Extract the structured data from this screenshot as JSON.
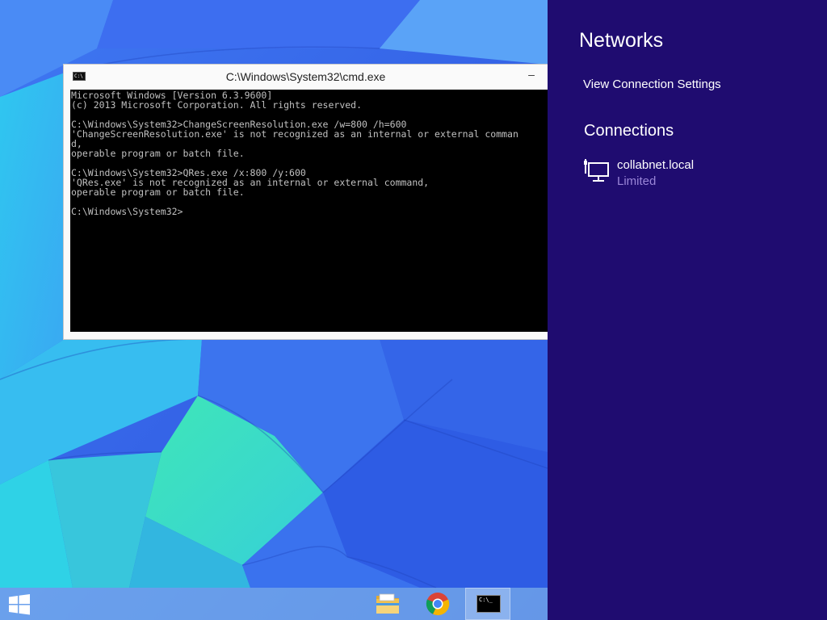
{
  "cmd": {
    "title": "C:\\Windows\\System32\\cmd.exe",
    "icon_text": "C:\\",
    "minimize_glyph": "–",
    "lines": [
      "Microsoft Windows [Version 6.3.9600]",
      "(c) 2013 Microsoft Corporation. All rights reserved.",
      "",
      "C:\\Windows\\System32>ChangeScreenResolution.exe /w=800 /h=600",
      "'ChangeScreenResolution.exe' is not recognized as an internal or external comman",
      "d,",
      "operable program or batch file.",
      "",
      "C:\\Windows\\System32>QRes.exe /x:800 /y:600",
      "'QRes.exe' is not recognized as an internal or external command,",
      "operable program or batch file.",
      "",
      "C:\\Windows\\System32>"
    ]
  },
  "charm": {
    "title": "Networks",
    "view_settings_label": "View Connection Settings",
    "connections_heading": "Connections",
    "connection": {
      "name": "collabnet.local",
      "status": "Limited",
      "icon": "wired-network-icon"
    },
    "colors": {
      "background": "#1f0c70",
      "status_text": "#9a86d8"
    }
  },
  "taskbar": {
    "items": [
      {
        "name": "file-explorer-icon"
      },
      {
        "name": "chrome-icon"
      },
      {
        "name": "command-prompt-icon",
        "active": true,
        "icon_text": "C:\\_"
      }
    ]
  }
}
